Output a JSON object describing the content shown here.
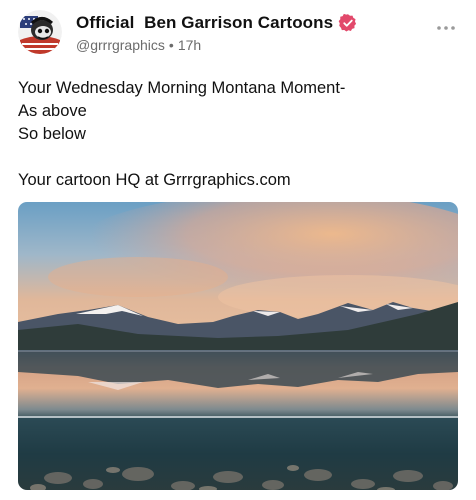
{
  "post": {
    "author": {
      "display_name": "Official  Ben Garrison Cartoons",
      "handle": "@grrrgraphics",
      "timestamp": "17h",
      "separator": "•",
      "verified": true,
      "verified_color": "#e2496b"
    },
    "body_lines": [
      "Your Wednesday Morning Montana Moment-",
      "As above",
      "So below",
      "",
      "Your cartoon HQ at Grrrgraphics.com"
    ],
    "image": {
      "icon": "landscape-photo",
      "subject": "mountain-lake-reflection"
    },
    "more_icon": "more-horizontal-icon"
  }
}
